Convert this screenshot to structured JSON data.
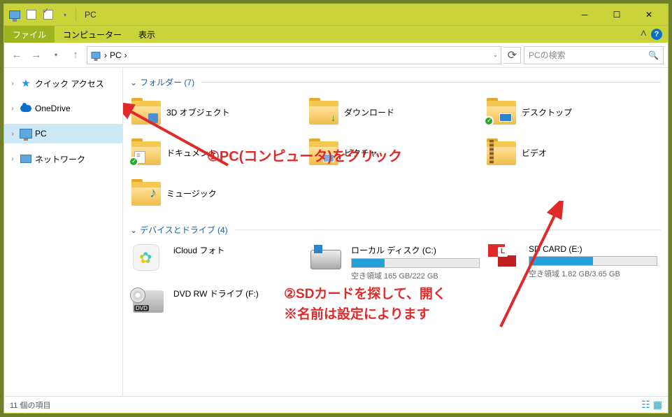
{
  "window": {
    "title": "PC"
  },
  "ribbon": {
    "file": "ファイル",
    "tabs": [
      "コンピューター",
      "表示"
    ]
  },
  "address": {
    "location": "PC",
    "sep": "›"
  },
  "search": {
    "placeholder": "PCの検索"
  },
  "sidebar": {
    "items": [
      {
        "label": "クイック アクセス"
      },
      {
        "label": "OneDrive"
      },
      {
        "label": "PC"
      },
      {
        "label": "ネットワーク"
      }
    ]
  },
  "groups": {
    "folders": {
      "header": "フォルダー (7)"
    },
    "drives": {
      "header": "デバイスとドライブ (4)"
    }
  },
  "folders": [
    "3D オブジェクト",
    "ダウンロード",
    "デスクトップ",
    "ドキュメント",
    "ピクチャ",
    "ビデオ",
    "ミュージック"
  ],
  "drives": {
    "icloud": {
      "name": "iCloud フォト"
    },
    "local": {
      "name": "ローカル ディスク (C:)",
      "sub": "空き領域 165 GB/222 GB",
      "fill": 26
    },
    "sd": {
      "name": "SD CARD (E:)",
      "sub": "空き領域 1.82 GB/3.65 GB",
      "fill": 50
    },
    "dvd": {
      "name": "DVD RW ドライブ (F:)"
    }
  },
  "annotations": {
    "a1": "①PC(コンピュータ)をクリック",
    "a2_l1": "②SDカードを探して、開く",
    "a2_l2": "※名前は設定によります"
  },
  "status": {
    "count": "11 個の項目"
  }
}
